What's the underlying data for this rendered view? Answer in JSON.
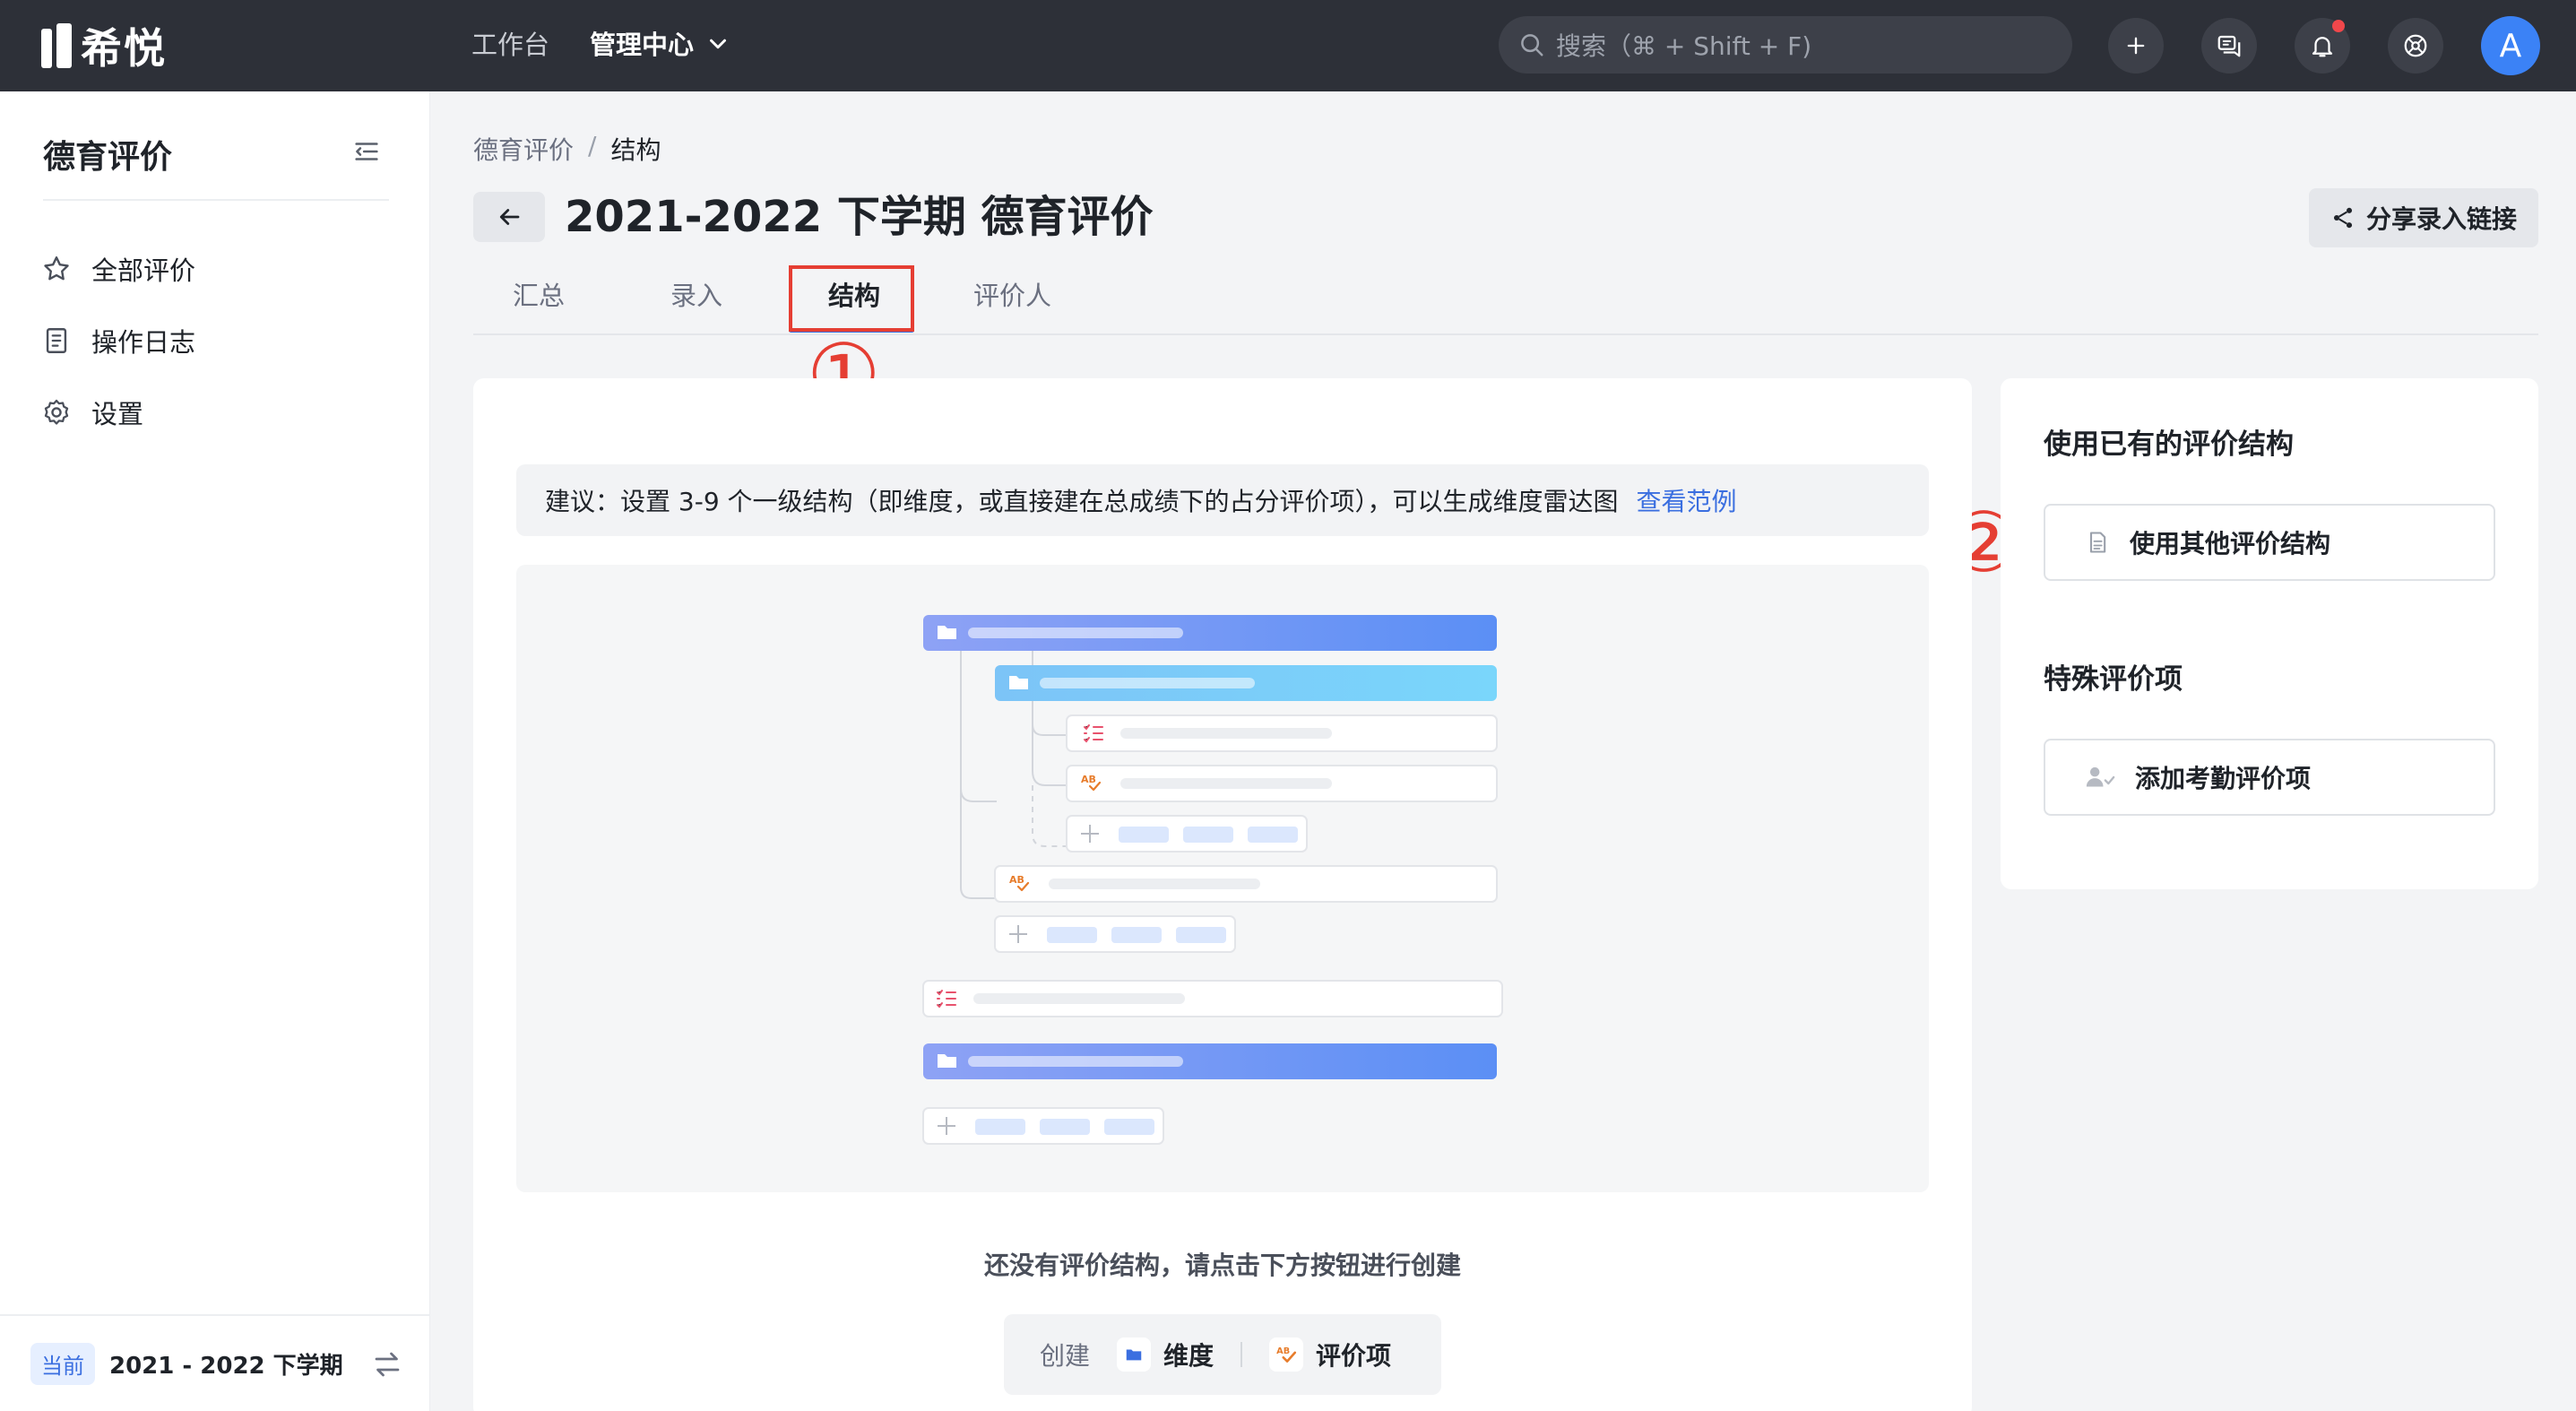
{
  "app": {
    "brand": "希悦"
  },
  "topnav": {
    "items": [
      {
        "label": "工作台",
        "active": false
      },
      {
        "label": "管理中心",
        "active": true
      }
    ],
    "search_placeholder": "搜索（⌘ + Shift + F)",
    "avatar_letter": "A",
    "has_unread_notification": true
  },
  "sidebar": {
    "title": "德育评价",
    "items": [
      {
        "label": "全部评价",
        "icon": "star-icon"
      },
      {
        "label": "操作日志",
        "icon": "log-icon"
      },
      {
        "label": "设置",
        "icon": "gear-icon"
      }
    ],
    "footer": {
      "badge": "当前",
      "term": "2021 - 2022 下学期"
    }
  },
  "breadcrumb": {
    "root": "德育评价",
    "sep": "/",
    "current": "结构"
  },
  "page": {
    "title": "2021-2022 下学期 德育评价",
    "share_label": "分享录入链接"
  },
  "tabs": [
    {
      "label": "汇总",
      "active": false
    },
    {
      "label": "录入",
      "active": false
    },
    {
      "label": "结构",
      "active": true
    },
    {
      "label": "评价人",
      "active": false
    }
  ],
  "annotations": {
    "first": "①",
    "second": "②"
  },
  "main": {
    "tip_text": "建议：设置 3-9 个一级结构（即维度，或直接建在总成绩下的占分评价项），可以生成维度雷达图",
    "tip_link": "查看范例",
    "empty_text": "还没有评价结构，请点击下方按钮进行创建",
    "create_lead": "创建",
    "create_dimension": "维度",
    "create_item": "评价项"
  },
  "right": {
    "existing_title": "使用已有的评价结构",
    "existing_button": "使用其他评价结构",
    "special_title": "特殊评价项",
    "attendance_button": "添加考勤评价项"
  },
  "colors": {
    "topbar": "#2d3038",
    "accent": "#3b6fe0",
    "annotation": "#e53e33",
    "folder_gradient_start": "#8ea2f5",
    "folder_gradient_end": "#5b8ff5",
    "subfolder_gradient_start": "#7cc4f7",
    "subfolder_gradient_end": "#7ad6fb"
  }
}
